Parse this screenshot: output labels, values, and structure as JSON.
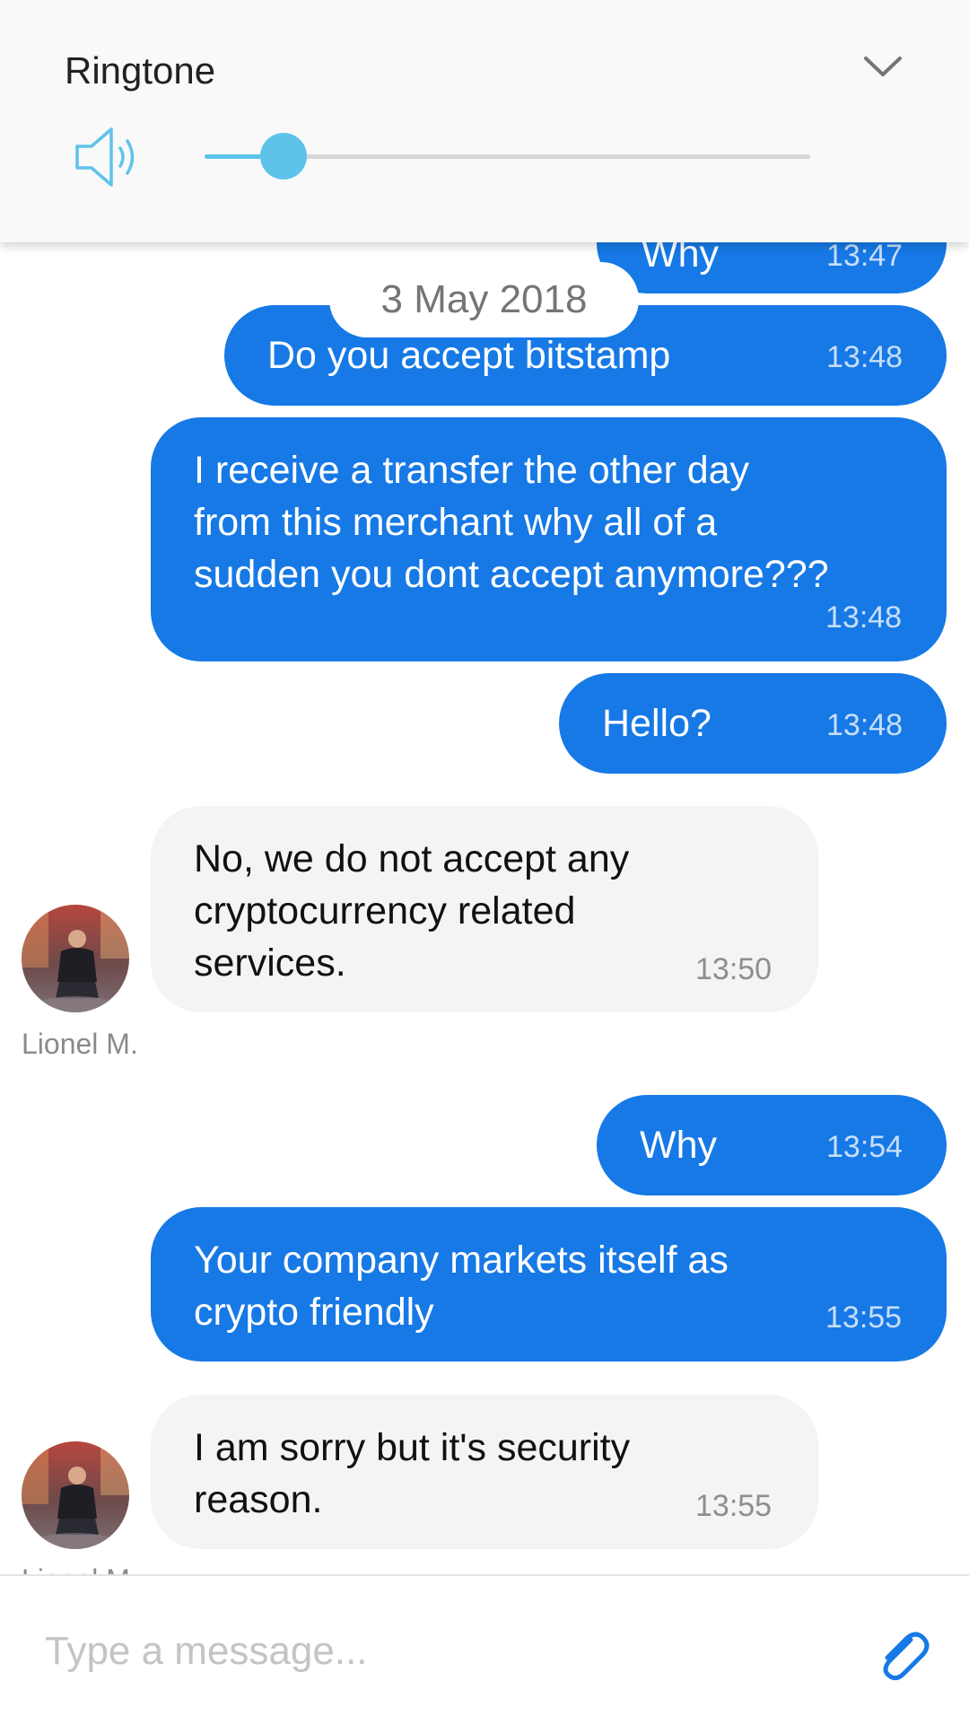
{
  "volume_panel": {
    "title": "Ringtone",
    "level": 0.13,
    "accent_color": "#5ec3ea",
    "icons": [
      "speaker-icon",
      "chevron-down-icon"
    ]
  },
  "date_separator": "3 May 2018",
  "messages": [
    {
      "id": "m0",
      "direction": "outgoing",
      "text": "Why",
      "time": "13:47"
    },
    {
      "id": "m1",
      "direction": "outgoing",
      "text": "Do you accept bitstamp",
      "time": "13:48"
    },
    {
      "id": "m2",
      "direction": "outgoing",
      "text": "I receive a transfer the other day\nfrom this merchant why all of a\nsudden you dont accept anymore???",
      "time": "13:48"
    },
    {
      "id": "m3",
      "direction": "outgoing",
      "text": "Hello?",
      "time": "13:48"
    },
    {
      "id": "m4",
      "direction": "incoming",
      "text": "No, we do not accept any\ncryptocurrency related\nservices.",
      "time": "13:50",
      "sender": "Lionel M."
    },
    {
      "id": "m5",
      "direction": "outgoing",
      "text": "Why",
      "time": "13:54"
    },
    {
      "id": "m6",
      "direction": "outgoing",
      "text": "Your company markets itself as\ncrypto friendly",
      "time": "13:55"
    },
    {
      "id": "m7",
      "direction": "incoming",
      "text": "I am sorry but it's security\nreason.",
      "time": "13:55",
      "sender": "Lionel M."
    }
  ],
  "composer": {
    "placeholder": "Type a message...",
    "value": "",
    "attach_icon": "paperclip-icon"
  },
  "colors": {
    "outgoing_bubble": "#1679e6",
    "incoming_bubble": "#f3f4f6",
    "accent": "#5ec3ea"
  }
}
